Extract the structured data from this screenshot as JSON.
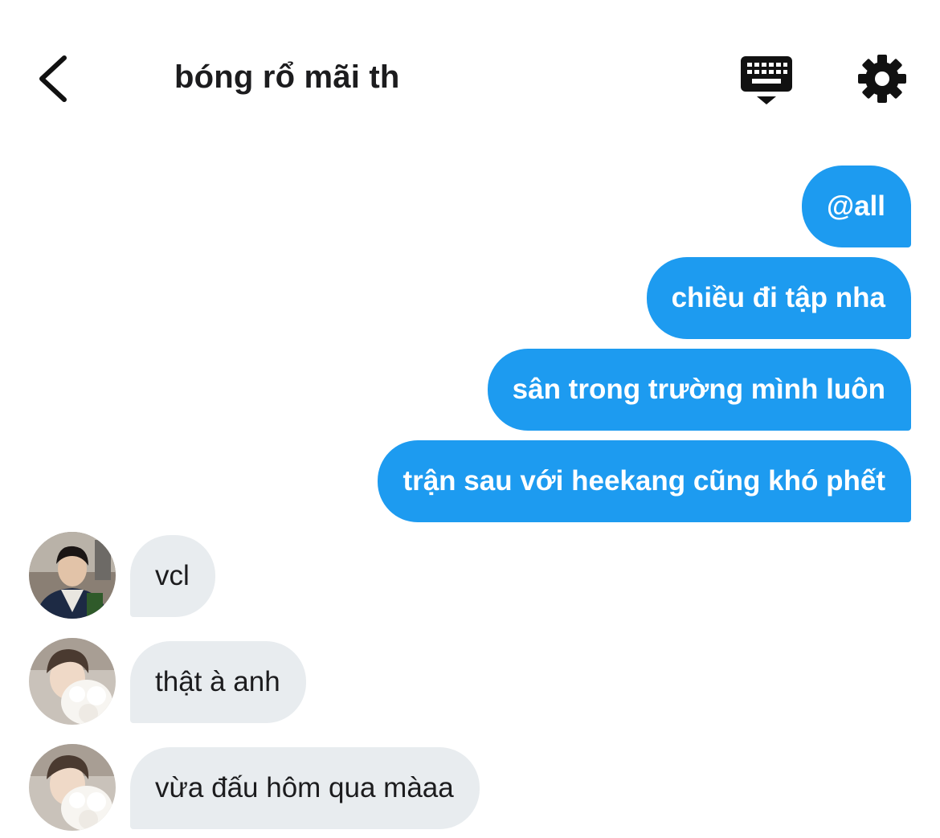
{
  "header": {
    "title": "bóng rổ mãi th",
    "back_icon": "chevron-left-icon",
    "keyboard_icon": "keyboard-dismiss-icon",
    "settings_icon": "gear-icon"
  },
  "messages_out": [
    {
      "text": "@all"
    },
    {
      "text": "chiều đi tập nha"
    },
    {
      "text": "sân trong trường mình luôn"
    },
    {
      "text": "trận sau với heekang cũng khó phết"
    }
  ],
  "messages_in": [
    {
      "text": "vcl"
    },
    {
      "text": "thật à anh"
    },
    {
      "text": "vừa đấu hôm qua màaa"
    }
  ],
  "colors": {
    "outgoing_bubble": "#1d9bf0",
    "incoming_bubble": "#e8ecef",
    "text_dark": "#1c1c1e",
    "text_light": "#ffffff"
  }
}
